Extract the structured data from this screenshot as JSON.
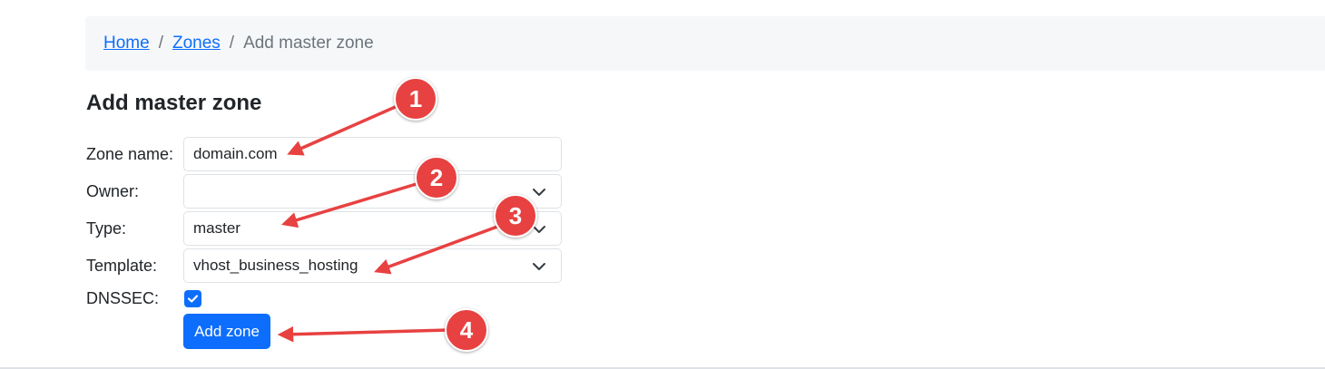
{
  "breadcrumb": {
    "home": "Home",
    "separator": "/",
    "zones": "Zones",
    "current": "Add master zone"
  },
  "page": {
    "title": "Add master zone"
  },
  "form": {
    "zone_name": {
      "label": "Zone name:",
      "value": "domain.com"
    },
    "owner": {
      "label": "Owner:",
      "value": ""
    },
    "type": {
      "label": "Type:",
      "value": "master"
    },
    "template": {
      "label": "Template:",
      "value": "vhost_business_hosting"
    },
    "dnssec": {
      "label": "DNSSEC:",
      "checked": true
    },
    "submit_label": "Add zone"
  },
  "annotations": [
    {
      "number": "1",
      "target": "zone-name-input"
    },
    {
      "number": "2",
      "target": "type-select"
    },
    {
      "number": "3",
      "target": "template-select"
    },
    {
      "number": "4",
      "target": "add-zone-button"
    }
  ],
  "colors": {
    "primary": "#0d6efd",
    "annotation": "#e84141",
    "breadcrumb_bg": "#f6f7f9"
  }
}
